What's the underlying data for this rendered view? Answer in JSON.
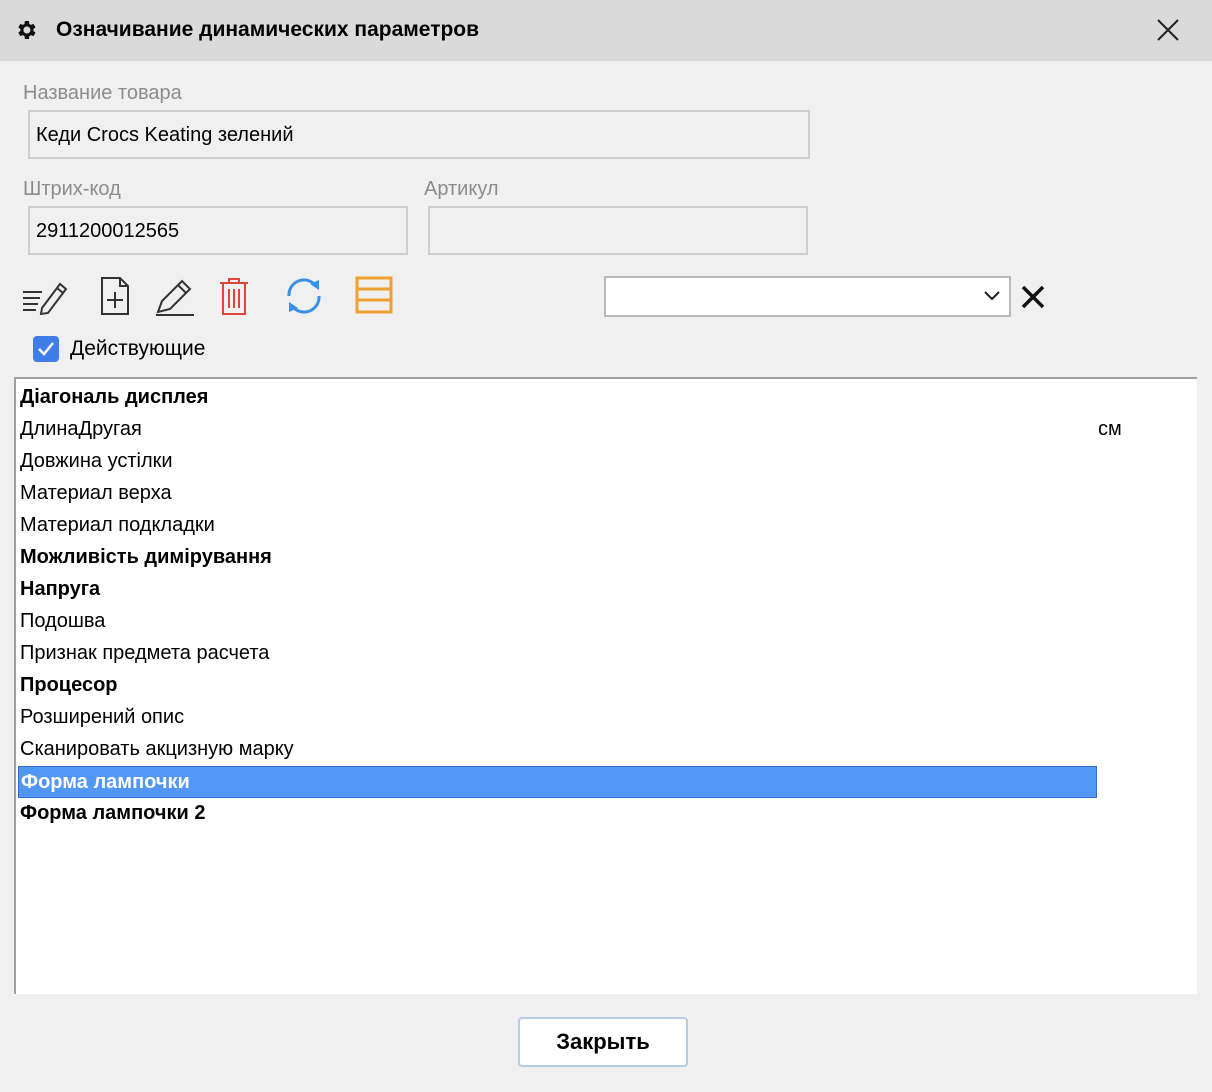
{
  "window": {
    "title": "Означивание динамических параметров"
  },
  "form": {
    "product_name_label": "Название товара",
    "product_name_value": "Кеди Crocs Keating зелений",
    "barcode_label": "Штрих-код",
    "barcode_value": "2911200012565",
    "article_label": "Артикул",
    "article_value": ""
  },
  "toolbar": {
    "icons": [
      "edit-list-icon",
      "add-document-icon",
      "pencil-icon",
      "delete-icon",
      "refresh-icon",
      "list-view-icon"
    ],
    "colors": {
      "delete": "#e0453a",
      "refresh": "#3a8fe8",
      "list_view": "#f0a030"
    }
  },
  "filter": {
    "selected": ""
  },
  "active_checkbox": {
    "label": "Действующие",
    "checked": true
  },
  "params": {
    "items": [
      {
        "label": "Діагональ дисплея",
        "unit": "",
        "bold": true,
        "selected": false
      },
      {
        "label": "ДлинаДругая",
        "unit": "см",
        "bold": false,
        "selected": false
      },
      {
        "label": "Довжина устілки",
        "unit": "",
        "bold": false,
        "selected": false
      },
      {
        "label": "Материал верха",
        "unit": "",
        "bold": false,
        "selected": false
      },
      {
        "label": "Материал подкладки",
        "unit": "",
        "bold": false,
        "selected": false
      },
      {
        "label": "Можливість димірування",
        "unit": "",
        "bold": true,
        "selected": false
      },
      {
        "label": "Напруга",
        "unit": "",
        "bold": true,
        "selected": false
      },
      {
        "label": "Подошва",
        "unit": "",
        "bold": false,
        "selected": false
      },
      {
        "label": "Признак предмета расчета",
        "unit": "",
        "bold": false,
        "selected": false
      },
      {
        "label": "Процесор",
        "unit": "",
        "bold": true,
        "selected": false
      },
      {
        "label": "Розширений опис",
        "unit": "",
        "bold": false,
        "selected": false
      },
      {
        "label": "Сканировать акцизную марку",
        "unit": "",
        "bold": false,
        "selected": false
      },
      {
        "label": "Форма лампочки",
        "unit": "",
        "bold": true,
        "selected": true
      },
      {
        "label": "Форма лампочки 2",
        "unit": "",
        "bold": true,
        "selected": false
      }
    ],
    "selection_color": "#5296f6"
  },
  "footer": {
    "close_label": "Закрыть"
  }
}
